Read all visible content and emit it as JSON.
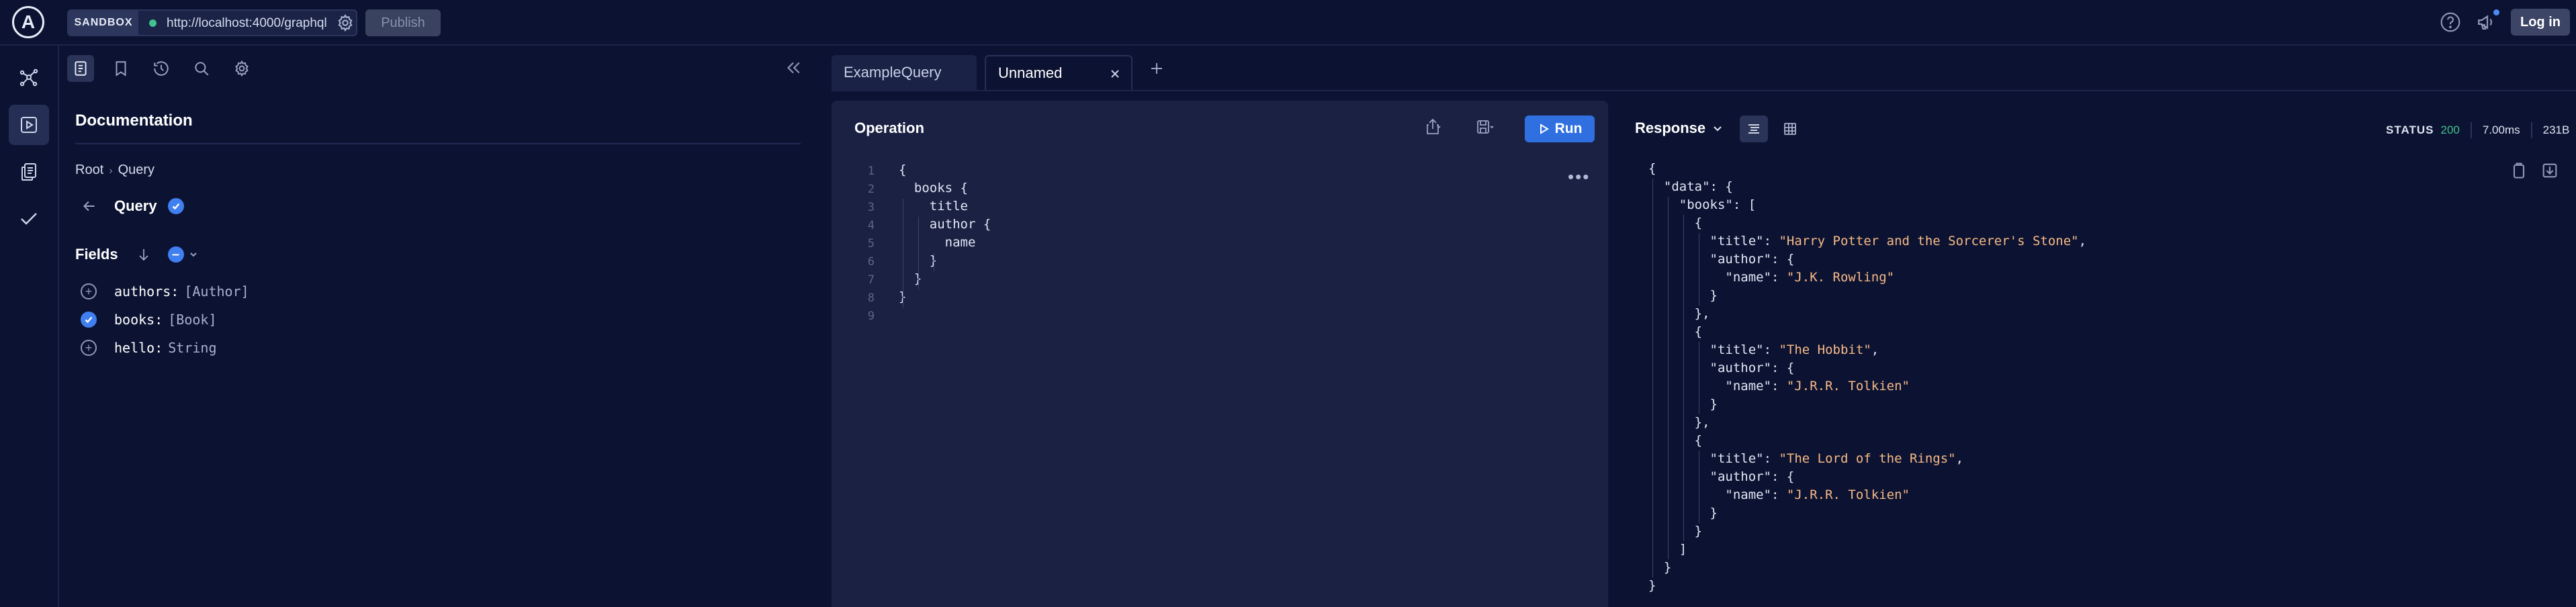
{
  "topbar": {
    "logo_letter": "A",
    "sandbox_label": "SANDBOX",
    "url": "http://localhost:4000/graphql",
    "publish_label": "Publish",
    "login_label": "Log in"
  },
  "rail": {
    "items": [
      {
        "icon": "schema-icon",
        "active": false
      },
      {
        "icon": "explorer-icon",
        "active": true
      },
      {
        "icon": "docs-copy-icon",
        "active": false
      },
      {
        "icon": "checkmark-icon",
        "active": false
      }
    ]
  },
  "docs": {
    "title": "Documentation",
    "breadcrumb": [
      "Root",
      "Query"
    ],
    "query_label": "Query",
    "fields_label": "Fields",
    "fields": [
      {
        "name": "authors:",
        "type": "[Author]",
        "selected": false
      },
      {
        "name": "books:",
        "type": "[Book]",
        "selected": true
      },
      {
        "name": "hello:",
        "type": "String",
        "selected": false
      }
    ]
  },
  "tabs": [
    {
      "label": "ExampleQuery",
      "active": false
    },
    {
      "label": "Unnamed",
      "active": true
    }
  ],
  "operation": {
    "title": "Operation",
    "run_label": "Run",
    "line_numbers": "1\n2\n3\n4\n5\n6\n7\n8\n9",
    "code": "{\n  books {\n    title\n    author {\n      name\n    }\n  }\n}\n"
  },
  "response": {
    "title": "Response",
    "status_label": "STATUS",
    "status_code": "200",
    "time": "7.00ms",
    "size": "231B",
    "lines": [
      [
        [
          "p",
          "{"
        ]
      ],
      [
        [
          "p",
          "  "
        ],
        [
          "k",
          "\"data\""
        ],
        [
          "p",
          ": {"
        ]
      ],
      [
        [
          "p",
          "    "
        ],
        [
          "k",
          "\"books\""
        ],
        [
          "p",
          ": ["
        ]
      ],
      [
        [
          "p",
          "      {"
        ]
      ],
      [
        [
          "p",
          "        "
        ],
        [
          "k",
          "\"title\""
        ],
        [
          "p",
          ": "
        ],
        [
          "s",
          "\"Harry Potter and the Sorcerer's Stone\""
        ],
        [
          "p",
          ","
        ]
      ],
      [
        [
          "p",
          "        "
        ],
        [
          "k",
          "\"author\""
        ],
        [
          "p",
          ": {"
        ]
      ],
      [
        [
          "p",
          "          "
        ],
        [
          "k",
          "\"name\""
        ],
        [
          "p",
          ": "
        ],
        [
          "s",
          "\"J.K. Rowling\""
        ]
      ],
      [
        [
          "p",
          "        }"
        ]
      ],
      [
        [
          "p",
          "      },"
        ]
      ],
      [
        [
          "p",
          "      {"
        ]
      ],
      [
        [
          "p",
          "        "
        ],
        [
          "k",
          "\"title\""
        ],
        [
          "p",
          ": "
        ],
        [
          "s",
          "\"The Hobbit\""
        ],
        [
          "p",
          ","
        ]
      ],
      [
        [
          "p",
          "        "
        ],
        [
          "k",
          "\"author\""
        ],
        [
          "p",
          ": {"
        ]
      ],
      [
        [
          "p",
          "          "
        ],
        [
          "k",
          "\"name\""
        ],
        [
          "p",
          ": "
        ],
        [
          "s",
          "\"J.R.R. Tolkien\""
        ]
      ],
      [
        [
          "p",
          "        }"
        ]
      ],
      [
        [
          "p",
          "      },"
        ]
      ],
      [
        [
          "p",
          "      {"
        ]
      ],
      [
        [
          "p",
          "        "
        ],
        [
          "k",
          "\"title\""
        ],
        [
          "p",
          ": "
        ],
        [
          "s",
          "\"The Lord of the Rings\""
        ],
        [
          "p",
          ","
        ]
      ],
      [
        [
          "p",
          "        "
        ],
        [
          "k",
          "\"author\""
        ],
        [
          "p",
          ": {"
        ]
      ],
      [
        [
          "p",
          "          "
        ],
        [
          "k",
          "\"name\""
        ],
        [
          "p",
          ": "
        ],
        [
          "s",
          "\"J.R.R. Tolkien\""
        ]
      ],
      [
        [
          "p",
          "        }"
        ]
      ],
      [
        [
          "p",
          "      }"
        ]
      ],
      [
        [
          "p",
          "    ]"
        ]
      ],
      [
        [
          "p",
          "  }"
        ]
      ],
      [
        [
          "p",
          "}"
        ]
      ]
    ]
  }
}
